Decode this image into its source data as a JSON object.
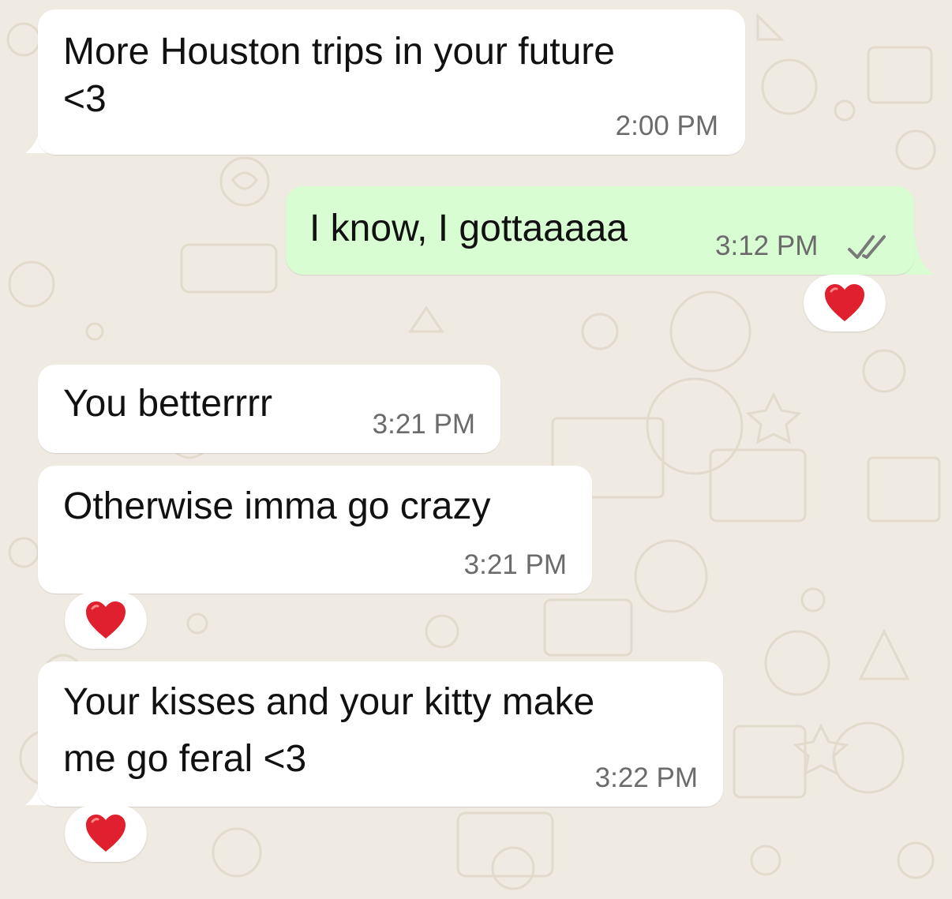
{
  "chat": {
    "messages": [
      {
        "direction": "incoming",
        "lines": [
          "More Houston trips in your future",
          "<3"
        ],
        "time": "2:00 PM",
        "reaction": null
      },
      {
        "direction": "outgoing",
        "lines": [
          "I know, I gottaaaaa"
        ],
        "time": "3:12 PM",
        "status": "read",
        "reaction": "heart"
      },
      {
        "direction": "incoming",
        "lines": [
          "You betterrrr"
        ],
        "time": "3:21 PM",
        "reaction": null
      },
      {
        "direction": "incoming",
        "lines": [
          "Otherwise imma go crazy"
        ],
        "time": "3:21 PM",
        "reaction": "heart"
      },
      {
        "direction": "incoming",
        "lines": [
          "Your kisses and your kitty make",
          "me go feral <3"
        ],
        "time": "3:22 PM",
        "reaction": "heart"
      }
    ]
  },
  "colors": {
    "background": "#efeae2",
    "incoming_bubble": "#ffffff",
    "outgoing_bubble": "#d9fdd3",
    "read_ticks": "#7a7a7a",
    "reaction_heart": "#e0202e"
  },
  "icons": {
    "read_receipt": "double-check-icon",
    "reaction": "red-heart-icon"
  }
}
